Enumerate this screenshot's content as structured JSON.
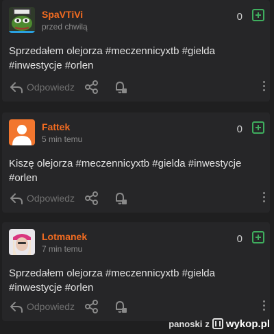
{
  "posts": [
    {
      "username": "SpaVTiVi",
      "time": "przed chwilą",
      "score": "0",
      "content": "Sprzedałem olejorza #meczennicyxtb #gielda #inwestycje #orlen",
      "reply_label": "Odpowiedz",
      "avatar_icon": "pepe-avatar"
    },
    {
      "username": "Fattek",
      "time": "5 min temu",
      "score": "0",
      "content": "Kiszę olejorza #meczennicyxtb #gielda #inwestycje #orlen",
      "reply_label": "Odpowiedz",
      "avatar_icon": "default-user-avatar"
    },
    {
      "username": "Lotmanek",
      "time": "7 min temu",
      "score": "0",
      "content": "Sprzedałem olejorza #meczennicyxtb #gielda #inwestycje #orlen",
      "reply_label": "Odpowiedz",
      "avatar_icon": "photo-avatar"
    }
  ],
  "watermark": {
    "user": "panoski",
    "separator": "z",
    "site": "wykop.pl"
  },
  "colors": {
    "username": "#f36c21",
    "plus": "#3fae5e",
    "background": "#1f1f20",
    "card": "#262628"
  }
}
